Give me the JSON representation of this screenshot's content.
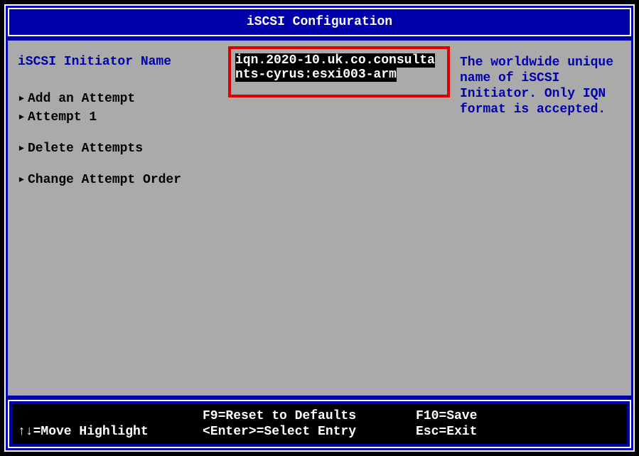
{
  "title": "iSCSI Configuration",
  "field": {
    "label": "iSCSI Initiator Name",
    "value_line1": "iqn.2020-10.uk.co.consulta",
    "value_line2": "nts-cyrus:esxi003-arm"
  },
  "menu": {
    "add_attempt": "Add an Attempt",
    "attempt_1": "Attempt 1",
    "delete_attempts": "Delete Attempts",
    "change_order": "Change Attempt Order"
  },
  "help": {
    "text1": "The worldwide unique",
    "text2": "name of iSCSI",
    "text3": "Initiator. Only IQN",
    "text4": " format is accepted."
  },
  "footer": {
    "r1c1": "",
    "r1c2": "F9=Reset to Defaults",
    "r1c3": "F10=Save",
    "r2c1": "↑↓=Move Highlight",
    "r2c2": "<Enter>=Select Entry",
    "r2c3": "Esc=Exit"
  },
  "glyphs": {
    "arrow": "▸"
  }
}
